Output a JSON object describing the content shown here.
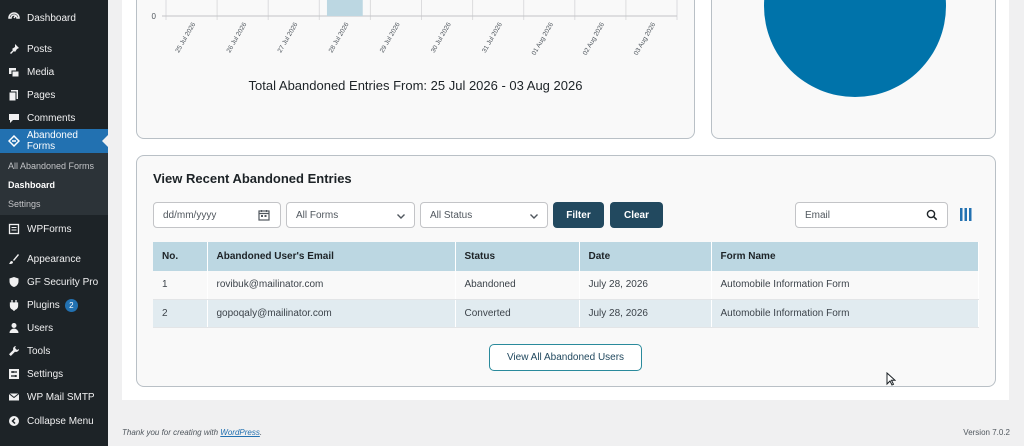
{
  "sidebar": {
    "items": [
      {
        "label": "Dashboard",
        "icon": "dashboard-icon"
      },
      {
        "label": "Posts",
        "icon": "pin-icon"
      },
      {
        "label": "Media",
        "icon": "media-icon"
      },
      {
        "label": "Pages",
        "icon": "pages-icon"
      },
      {
        "label": "Comments",
        "icon": "comment-icon"
      },
      {
        "label": "Abandoned Forms",
        "icon": "abandoned-forms-icon",
        "active": true
      },
      {
        "label": "WPForms",
        "icon": "wpforms-icon"
      },
      {
        "label": "Appearance",
        "icon": "brush-icon"
      },
      {
        "label": "GF Security Pro",
        "icon": "shield-icon"
      },
      {
        "label": "Plugins",
        "icon": "plugin-icon",
        "badge": "2"
      },
      {
        "label": "Users",
        "icon": "user-icon"
      },
      {
        "label": "Tools",
        "icon": "wrench-icon"
      },
      {
        "label": "Settings",
        "icon": "settings-icon"
      },
      {
        "label": "WP Mail SMTP",
        "icon": "mail-icon"
      },
      {
        "label": "Collapse Menu",
        "icon": "collapse-icon"
      }
    ],
    "submenu": [
      "All Abandoned Forms",
      "Dashboard",
      "Settings"
    ]
  },
  "chart_data": {
    "type": "bar",
    "categories": [
      "25 Jul 2026",
      "26 Jul 2026",
      "27 Jul 2026",
      "28 Jul 2026",
      "29 Jul 2026",
      "30 Jul 2026",
      "31 Jul 2026",
      "01 Aug 2026",
      "02 Aug 2026",
      "03 Aug 2026"
    ],
    "values": [
      0,
      0,
      0,
      2,
      0,
      0,
      0,
      0,
      0,
      0
    ],
    "y_tick_visible": "0",
    "title": "Total Abandoned Entries From: 25 Jul 2026 - 03 Aug 2026",
    "bar_color": "#bcd7e2"
  },
  "pie": {
    "color": "#0073aa"
  },
  "entries": {
    "title": "View Recent Abandoned Entries",
    "date_placeholder": "dd/mm/yyyy",
    "forms_select": "All Forms",
    "status_select": "All Status",
    "filter_label": "Filter",
    "clear_label": "Clear",
    "email_placeholder": "Email",
    "columns": [
      "No.",
      "Abandoned User's Email",
      "Status",
      "Date",
      "Form Name"
    ],
    "rows": [
      [
        "1",
        "rovibuk@mailinator.com",
        "Abandoned",
        "July 28, 2026",
        "Automobile Information Form"
      ],
      [
        "2",
        "gopoqaly@mailinator.com",
        "Converted",
        "July 28, 2026",
        "Automobile Information Form"
      ]
    ],
    "view_all_label": "View All Abandoned Users"
  },
  "footer": {
    "thanks_prefix": "Thank you for creating with ",
    "wordpress_link": "WordPress",
    "thanks_suffix": ".",
    "version": "Version 7.0.2"
  },
  "colors": {
    "accent": "#2271b1",
    "button_dark": "#22495f",
    "header_row": "#bcd7e2"
  }
}
